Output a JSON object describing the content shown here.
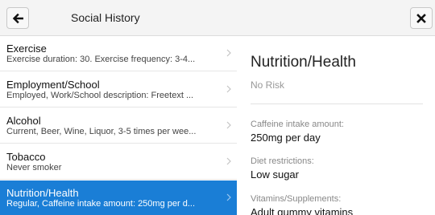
{
  "header": {
    "title": "Social History",
    "back_icon": "arrow-left-icon",
    "close_icon": "close-icon"
  },
  "list": {
    "items": [
      {
        "title": "Exercise",
        "subtitle": "Exercise duration: 30. Exercise frequency: 3-4...",
        "selected": false
      },
      {
        "title": "Employment/School",
        "subtitle": "Employed, Work/School description: Freetext ...",
        "selected": false
      },
      {
        "title": "Alcohol",
        "subtitle": "Current, Beer, Wine, Liquor, 3-5 times per wee...",
        "selected": false
      },
      {
        "title": "Tobacco",
        "subtitle": "Never smoker",
        "selected": false
      },
      {
        "title": "Nutrition/Health",
        "subtitle": "Regular, Caffeine intake amount: 250mg per d...",
        "selected": true
      }
    ],
    "selected_color": "#1a7ed6"
  },
  "detail": {
    "title": "Nutrition/Health",
    "risk": "No Risk",
    "fields": [
      {
        "label": "Caffeine intake amount:",
        "value": "250mg per day"
      },
      {
        "label": "Diet restrictions:",
        "value": "Low sugar"
      },
      {
        "label": "Vitamins/Supplements:",
        "value": "Adult gummy vitamins"
      }
    ]
  }
}
